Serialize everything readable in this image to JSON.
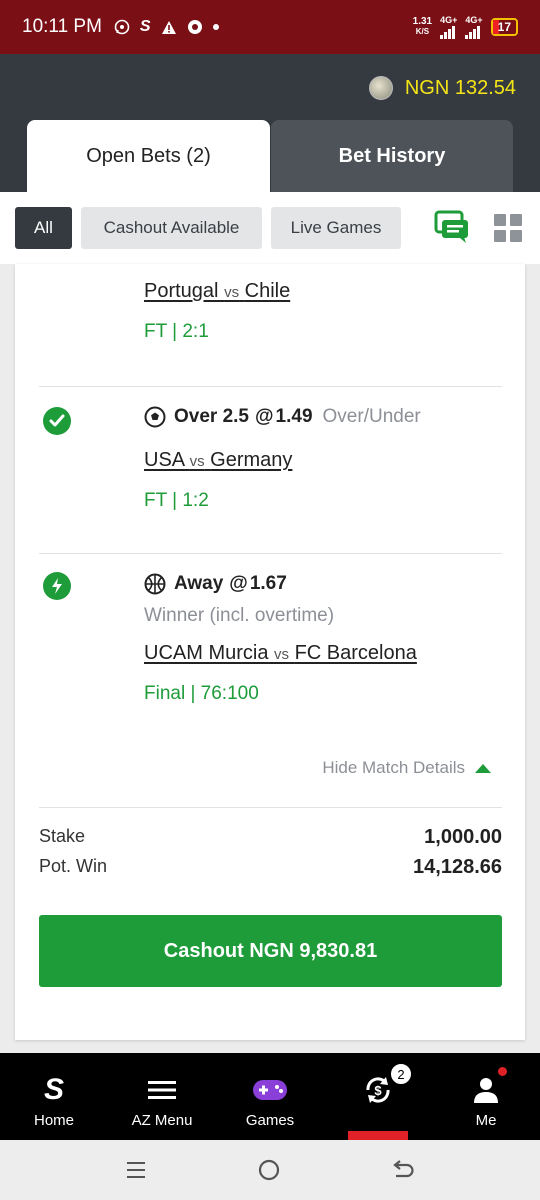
{
  "status_bar": {
    "time": "10:11 PM",
    "net_speed": "1.31",
    "net_unit": "K/S",
    "net1": "4G+",
    "net2": "4G+",
    "battery": "17"
  },
  "header": {
    "balance": "NGN 132.54",
    "tabs": [
      {
        "label": "Open Bets (2)",
        "active": true
      },
      {
        "label": "Bet History",
        "active": false
      }
    ]
  },
  "filters": {
    "chips": [
      "All",
      "Cashout Available",
      "Live Games"
    ]
  },
  "bet": {
    "legs": [
      {
        "match_home": "Portugal",
        "vs": "vs",
        "match_away": "Chile",
        "result": "FT | 2:1"
      },
      {
        "status_icon": "check-icon",
        "sport_icon": "soccer-ball-icon",
        "selection": "Over 2.5",
        "at": "@",
        "odds": "1.49",
        "market": "Over/Under",
        "match_home": "USA",
        "vs": "vs",
        "match_away": "Germany",
        "result": "FT | 1:2"
      },
      {
        "status_icon": "lightning-icon",
        "sport_icon": "basketball-icon",
        "selection": "Away",
        "at": "@",
        "odds": "1.67",
        "market": "Winner (incl. overtime)",
        "match_home": "UCAM Murcia",
        "vs": "vs",
        "match_away": "FC Barcelona",
        "result": "Final | 76:100"
      }
    ],
    "hide_details": "Hide Match Details",
    "stake_label": "Stake",
    "stake_value": "1,000.00",
    "potwin_label": "Pot. Win",
    "potwin_value": "14,128.66",
    "cashout_label": "Cashout NGN 9,830.81"
  },
  "bottom_nav": {
    "items": [
      {
        "label": "Home",
        "icon": "sportybet-logo-icon"
      },
      {
        "label": "AZ Menu",
        "icon": "menu-icon"
      },
      {
        "label": "Games",
        "icon": "gamepad-icon"
      },
      {
        "label": "",
        "icon": "cashout-icon",
        "badge": "2"
      },
      {
        "label": "Me",
        "icon": "user-icon"
      }
    ]
  },
  "colors": {
    "status_bar": "#7a0f16",
    "header": "#353a40",
    "accent_green": "#1e9c3a",
    "balance_yellow": "#f5e417",
    "nav_red": "#e02228"
  }
}
